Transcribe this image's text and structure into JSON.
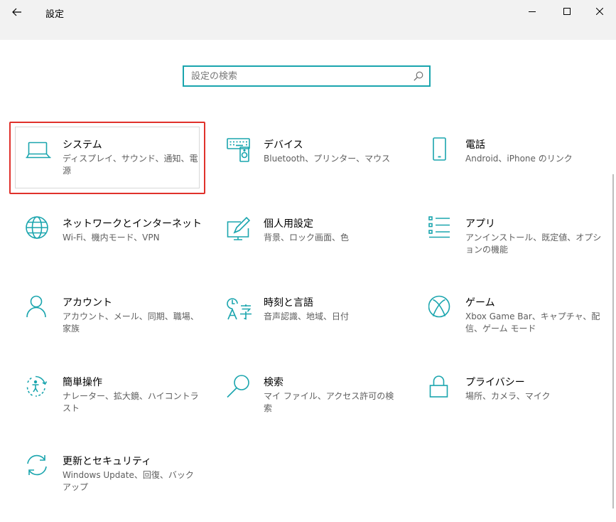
{
  "window": {
    "title": "設定"
  },
  "search": {
    "placeholder": "設定の検索"
  },
  "categories": [
    {
      "name": "システム",
      "desc": "ディスプレイ、サウンド、通知、電源",
      "icon": "laptop-icon"
    },
    {
      "name": "デバイス",
      "desc": "Bluetooth、プリンター、マウス",
      "icon": "keyboard-speaker-icon"
    },
    {
      "name": "電話",
      "desc": "Android、iPhone のリンク",
      "icon": "phone-icon"
    },
    {
      "name": "ネットワークとインターネット",
      "desc": "Wi-Fi、機内モード、VPN",
      "icon": "globe-icon"
    },
    {
      "name": "個人用設定",
      "desc": "背景、ロック画面、色",
      "icon": "paint-icon"
    },
    {
      "name": "アプリ",
      "desc": "アンインストール、既定値、オプションの機能",
      "icon": "apps-list-icon"
    },
    {
      "name": "アカウント",
      "desc": "アカウント、メール、同期、職場、家族",
      "icon": "person-icon"
    },
    {
      "name": "時刻と言語",
      "desc": "音声認識、地域、日付",
      "icon": "time-language-icon"
    },
    {
      "name": "ゲーム",
      "desc": "Xbox Game Bar、キャプチャ、配信、ゲーム モード",
      "icon": "xbox-icon"
    },
    {
      "name": "簡単操作",
      "desc": "ナレーター、拡大鏡、ハイコントラスト",
      "icon": "ease-of-access-icon"
    },
    {
      "name": "検索",
      "desc": "マイ ファイル、アクセス許可の検索",
      "icon": "search-icon"
    },
    {
      "name": "プライバシー",
      "desc": "場所、カメラ、マイク",
      "icon": "lock-icon"
    },
    {
      "name": "更新とセキュリティ",
      "desc": "Windows Update、回復、バックアップ",
      "icon": "sync-icon"
    }
  ],
  "colors": {
    "accent": "#1aa5ae",
    "highlight": "#e0312b"
  }
}
